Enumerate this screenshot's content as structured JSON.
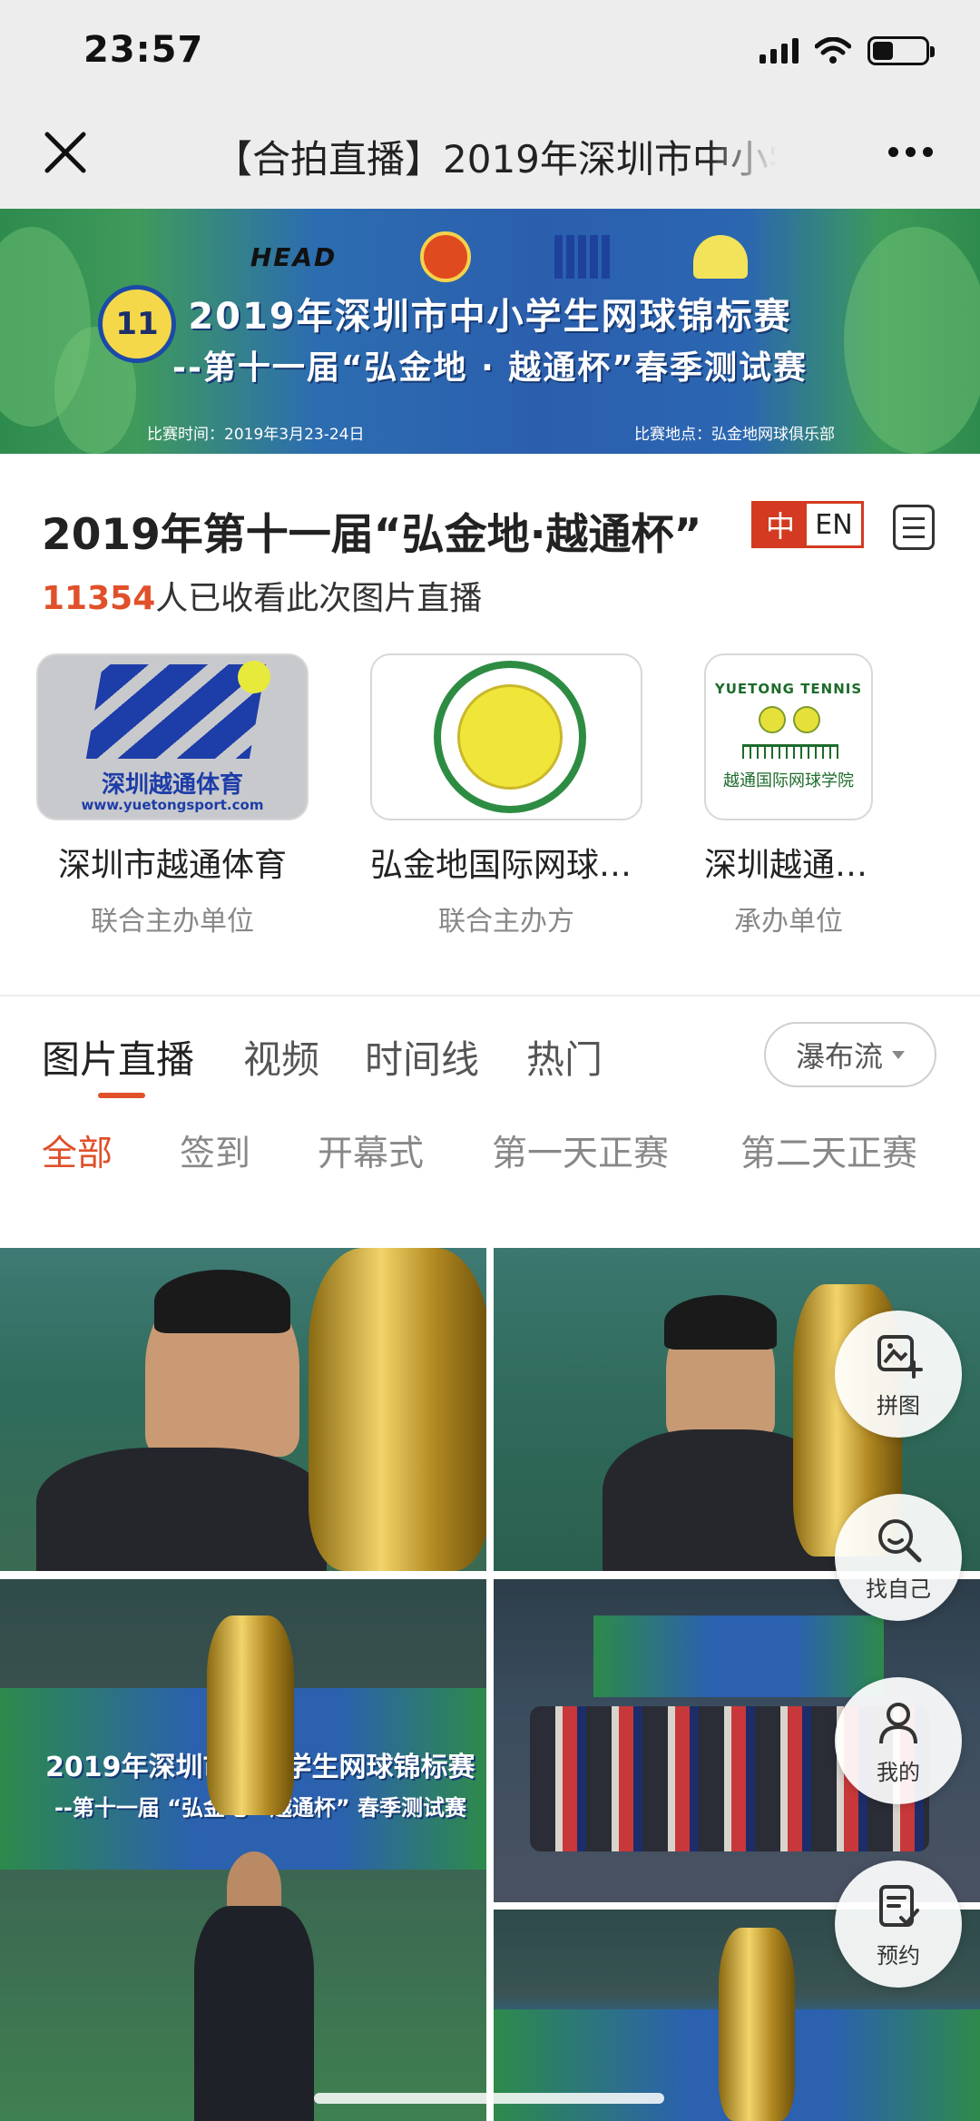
{
  "status_bar": {
    "time": "23:57"
  },
  "nav": {
    "title": "【合拍直播】2019年深圳市中小学"
  },
  "banner": {
    "brand": "HEAD",
    "title": "2019年深圳市中小学生网球锦标赛",
    "subtitle": "--第十一届“弘金地 · 越通杯”春季测试赛",
    "time": "比赛时间：2019年3月23-24日",
    "venue": "比赛地点：弘金地网球俱乐部",
    "mascot_number": "11"
  },
  "event": {
    "title": "2019年第十一届“弘金地·越通杯”",
    "view_count": "11354",
    "view_suffix": "人已收看此次图片直播",
    "lang_zh": "中",
    "lang_en": "EN"
  },
  "organizers": [
    {
      "name": "深圳市越通体育",
      "role": "联合主办单位",
      "logo_text": "深圳越通体育",
      "logo_url": "www.yuetongsport.com"
    },
    {
      "name": "弘金地国际网球俱乐部",
      "role": "联合主办方"
    },
    {
      "name": "深圳越通国际网球学院",
      "role": "承办单位",
      "logo_text_top": "YUETONG TENNIS",
      "logo_text_bottom": "越通国际网球学院"
    }
  ],
  "tabs": [
    "图片直播",
    "视频",
    "时间线",
    "热门"
  ],
  "layout_button": "瀑布流",
  "categories": [
    "全部",
    "签到",
    "开幕式",
    "第一天正赛",
    "第二天正赛"
  ],
  "photos": {
    "banner_title": "2019年深圳市中小学生网球锦标赛",
    "banner_subtitle": "--第十一届 “弘金地 · 越通杯” 春季测试赛"
  },
  "fabs": [
    {
      "label": "拼图",
      "icon": "collage-icon"
    },
    {
      "label": "找自己",
      "icon": "face-search-icon"
    },
    {
      "label": "我的",
      "icon": "user-icon"
    },
    {
      "label": "预约",
      "icon": "booking-icon"
    }
  ],
  "colors": {
    "accent": "#e0502a",
    "lang_red": "#d33a21",
    "nav_bg": "#ededed"
  }
}
